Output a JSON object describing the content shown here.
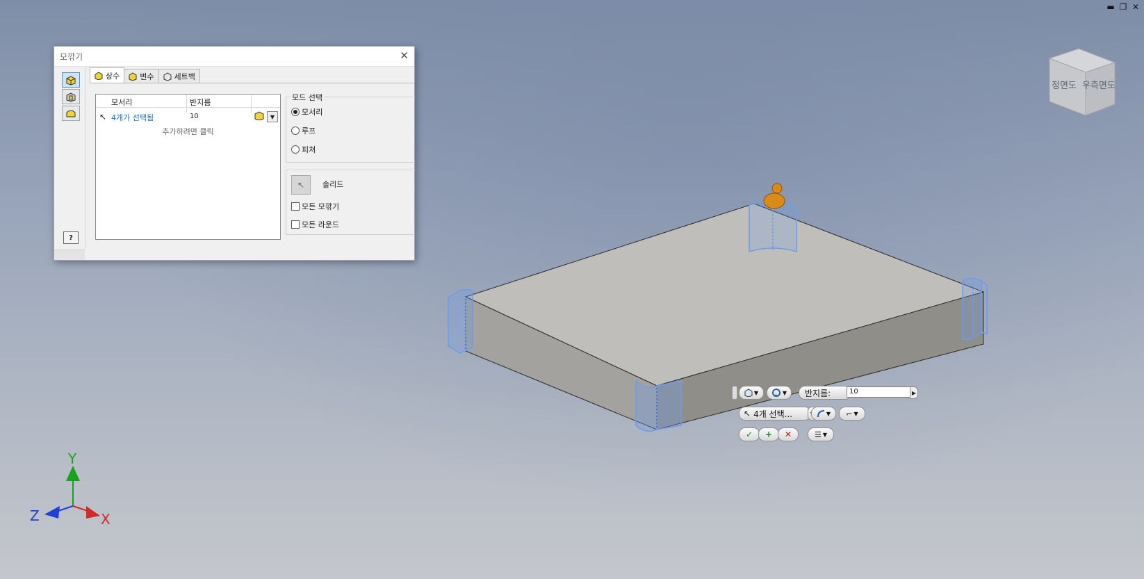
{
  "window_controls": {
    "minimize": "▬",
    "restore": "❐",
    "close": "✕"
  },
  "dialog": {
    "title": "모깎기",
    "close_glyph": "✕",
    "tabs": [
      "상수",
      "변수",
      "세트백"
    ],
    "table": {
      "col_edge": "모서리",
      "col_radius": "반지름",
      "row_edge": "4개가 선택됨",
      "row_radius": "10",
      "add_hint": "추가하려면 클릭"
    },
    "mode_group": {
      "legend": "모드 선택",
      "options": [
        "모서리",
        "루프",
        "피쳐"
      ],
      "selected_index": 0
    },
    "solid_label": "솔리드",
    "checkboxes": [
      "모든 모깎기",
      "모든 라운드"
    ],
    "help_glyph": "?"
  },
  "mini_toolbar": {
    "radius_label": "반지름:",
    "radius_value": "10",
    "edge_selection": "4개 선택...",
    "ok_glyph": "✓",
    "apply_glyph": "+",
    "cancel_glyph": "✕"
  },
  "view_cube": {
    "front": "정면도",
    "right": "우측면도"
  },
  "axes": {
    "x": "X",
    "y": "Y",
    "z": "Z",
    "x_color": "#d12a2a",
    "y_color": "#1ca11c",
    "z_color": "#1f3fd6"
  },
  "colors": {
    "highlight": "#6f9be8",
    "part_top": "#bfbebb",
    "part_front": "#9e9d99",
    "part_side": "#8f8e89"
  }
}
